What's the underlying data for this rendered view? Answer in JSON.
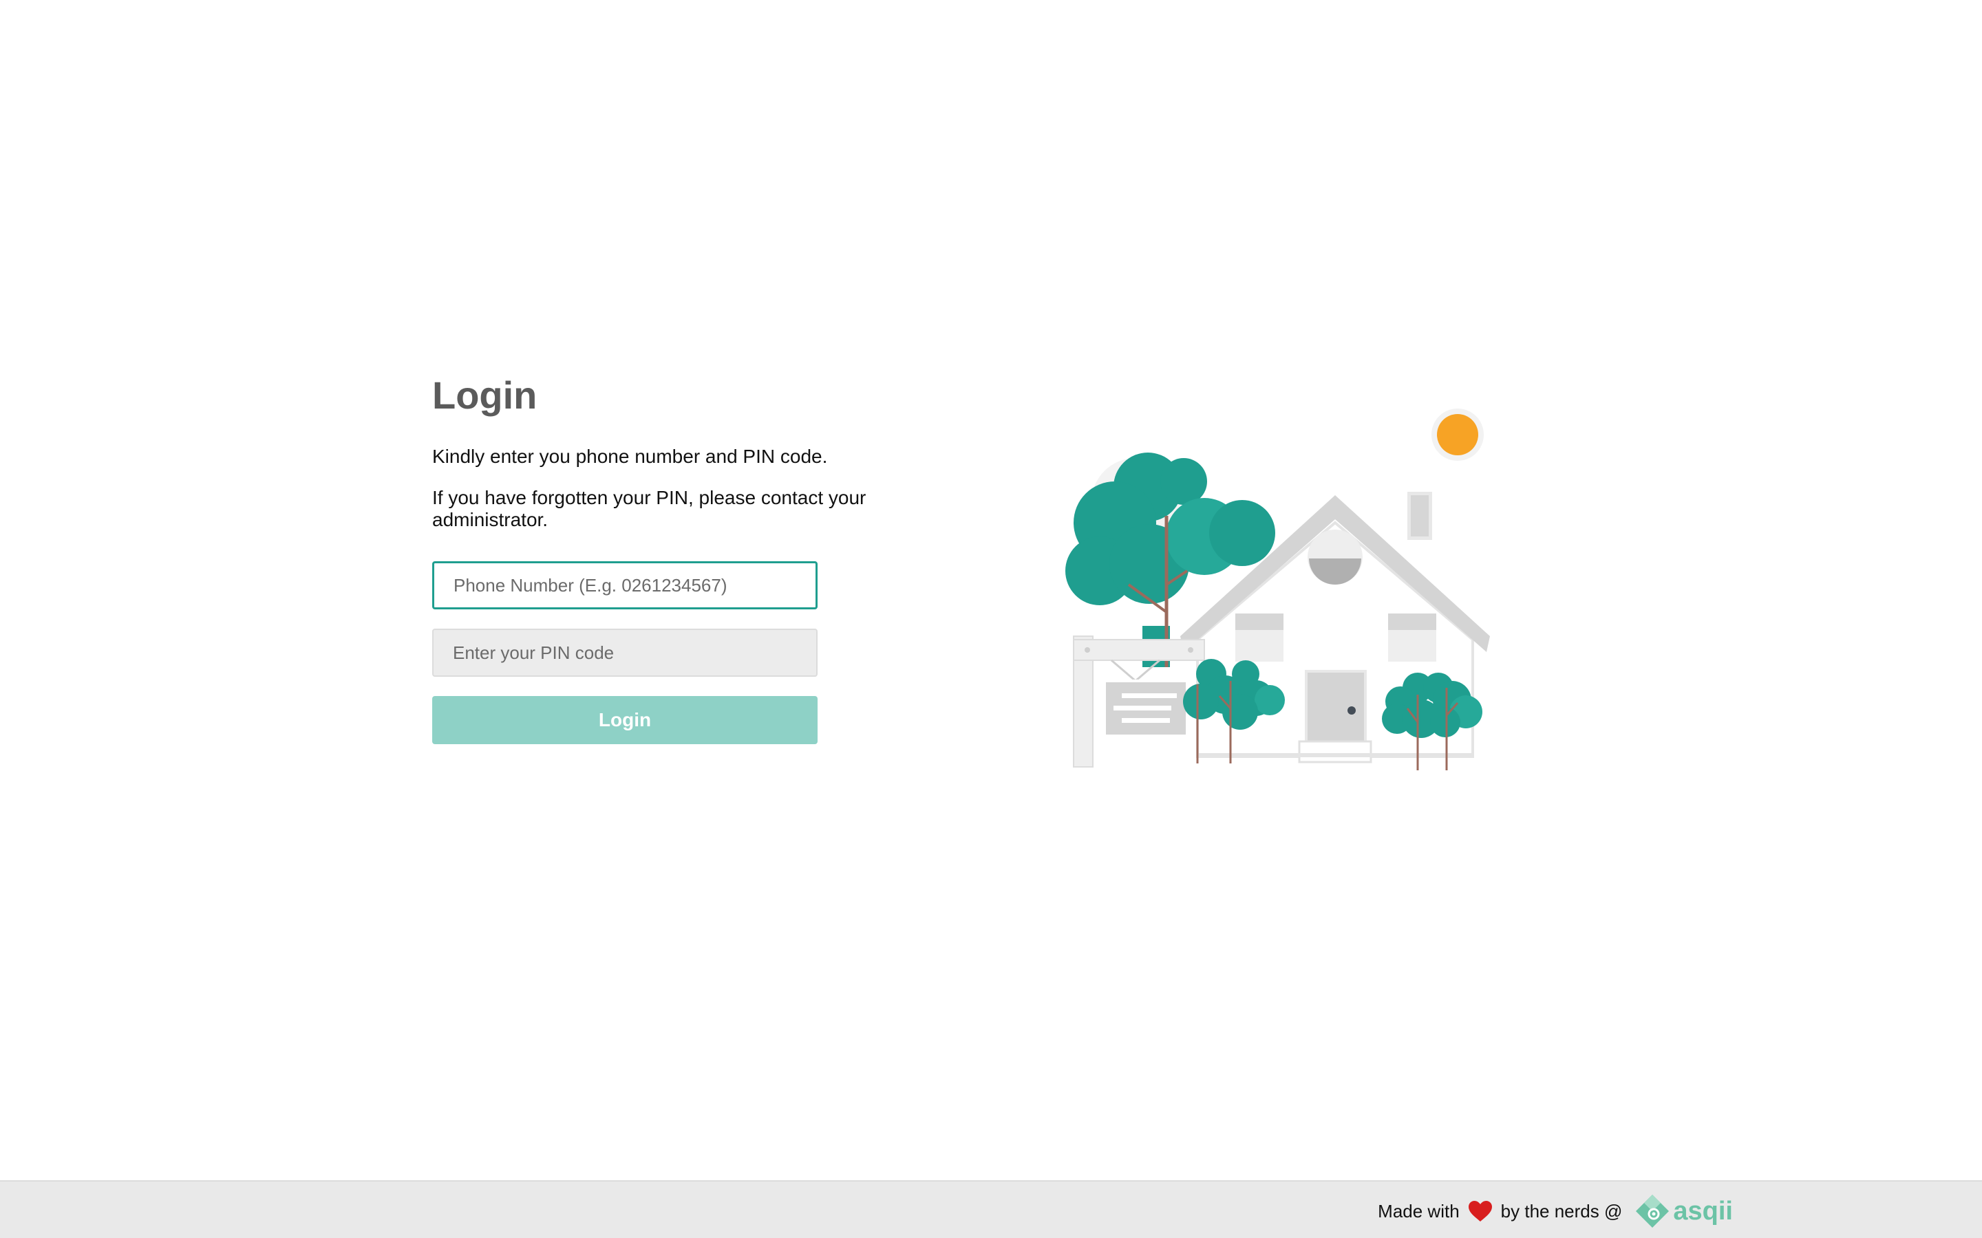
{
  "login": {
    "title": "Login",
    "instruction_1": "Kindly enter you phone number and PIN code.",
    "instruction_2": "If you have forgotten your PIN, please contact your administrator.",
    "phone_placeholder": "Phone Number (E.g. 0261234567)",
    "phone_value": "",
    "pin_placeholder": "Enter your PIN code",
    "pin_value": "",
    "button_label": "Login"
  },
  "illustration": {
    "name": "house-illustration",
    "colors": {
      "tree": "#1f9e8f",
      "sun": "#f7a325",
      "house": "#d4d4d4"
    }
  },
  "footer": {
    "made_with": "Made with",
    "by_nerds": "by the nerds @",
    "brand": "asqii",
    "heart_icon": "heart-icon",
    "brand_color": "#6cc3a6",
    "heart_color": "#d81e1e"
  },
  "colors": {
    "accent": "#1f9e8f",
    "button": "#8ed1c6",
    "title": "#5b5b5b"
  }
}
